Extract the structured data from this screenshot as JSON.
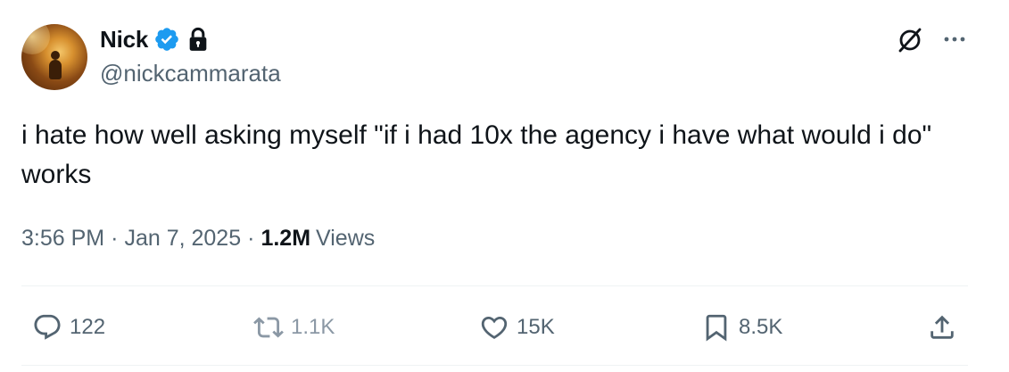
{
  "author": {
    "name": "Nick",
    "handle": "@nickcammarata",
    "verified": true,
    "protected": true
  },
  "icons": {
    "avatar": "avatar-image",
    "verified": "verified-badge-icon",
    "lock": "lock-icon",
    "grok": "grok-icon",
    "more": "more-icon",
    "reply": "reply-icon",
    "repost": "repost-icon",
    "like": "heart-icon",
    "bookmark": "bookmark-icon",
    "share": "share-icon"
  },
  "colors": {
    "text": "#0f1419",
    "secondary": "#536471",
    "verified": "#1d9bf0",
    "divider": "#eff3f4"
  },
  "post": {
    "text": "i hate how well asking myself \"if i had 10x the agency i have what would i do\" works",
    "time": "3:56 PM",
    "separator": "·",
    "date": "Jan 7, 2025",
    "views_count": "1.2M",
    "views_label": "Views"
  },
  "actions": {
    "replies": "122",
    "reposts": "1.1K",
    "likes": "15K",
    "bookmarks": "8.5K"
  }
}
